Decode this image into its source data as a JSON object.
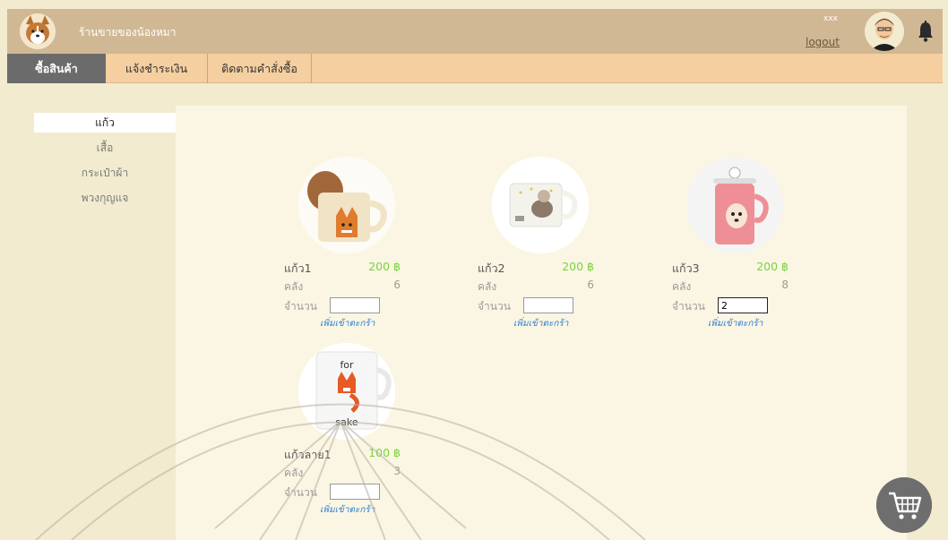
{
  "header": {
    "shop_name": "ร้านขายของน้องหมา",
    "username": "xxx",
    "logout_label": "logout"
  },
  "nav": {
    "tabs": [
      {
        "label": "ซื้อสินค้า",
        "active": true
      },
      {
        "label": "แจ้งชำระเงิน",
        "active": false
      },
      {
        "label": "ติดตามคำสั่งซื้อ",
        "active": false
      }
    ]
  },
  "sidebar": {
    "items": [
      {
        "label": "แก้ว",
        "active": true
      },
      {
        "label": "เสื้อ",
        "active": false
      },
      {
        "label": "กระเป๋าผ้า",
        "active": false
      },
      {
        "label": "พวงกุญแจ",
        "active": false
      }
    ]
  },
  "products": [
    {
      "name": "แก้ว1",
      "price": "200 ฿",
      "stock_label": "คลัง",
      "stock": "6",
      "qty_label": "จำนวน",
      "qty": "",
      "add_label": "เพิ่มเข้าตะกร้า",
      "image": "fox-mug-image"
    },
    {
      "name": "แก้ว2",
      "price": "200 ฿",
      "stock_label": "คลัง",
      "stock": "6",
      "qty_label": "จำนวน",
      "qty": "",
      "add_label": "เพิ่มเข้าตะกร้า",
      "image": "dog-mug-image"
    },
    {
      "name": "แก้ว3",
      "price": "200 ฿",
      "stock_label": "คลัง",
      "stock": "8",
      "qty_label": "จำนวน",
      "qty": "2",
      "add_label": "เพิ่มเข้าตะกร้า",
      "image": "pink-mug-image"
    },
    {
      "name": "แก้วลาย1",
      "price": "100 ฿",
      "stock_label": "คลัง",
      "stock": "3",
      "qty_label": "จำนวน",
      "qty": "",
      "add_label": "เพิ่มเข้าตะกร้า",
      "image": "for-fox-sake-mug-image",
      "mug_text_top": "for",
      "mug_text_bottom": "sake"
    }
  ],
  "icons": {
    "logo": "corgi-logo-icon",
    "avatar": "user-avatar-icon",
    "bell": "bell-icon",
    "cart": "shopping-cart-icon"
  },
  "colors": {
    "header_bg": "#d1b894",
    "nav_bg": "#f5cfa0",
    "active_tab": "#6b6b6b",
    "price": "#7bd13f",
    "link": "#2b7fd4",
    "accent_bracket": "#2b9fd9",
    "page_bg": "#f2ebcf",
    "content_bg": "#fbf6e3"
  }
}
